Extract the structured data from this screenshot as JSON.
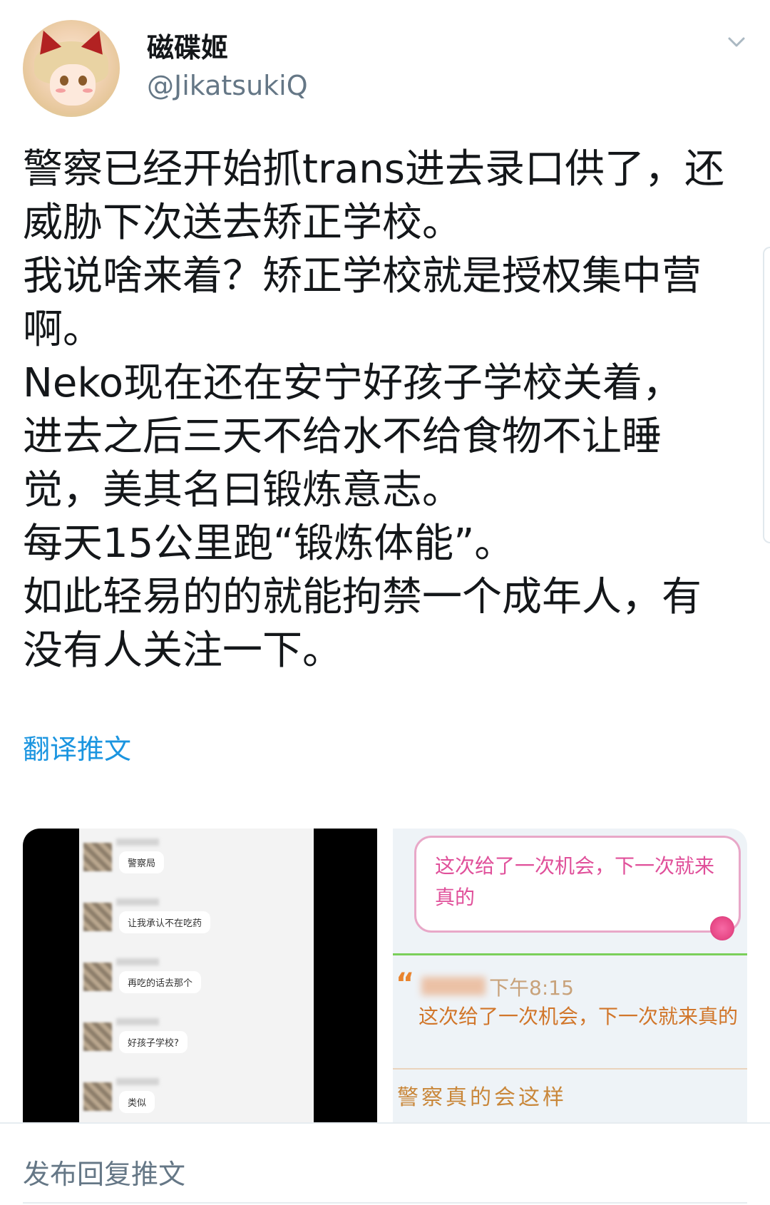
{
  "user": {
    "display_name": "磁碟姬",
    "handle": "@JikatsukiQ"
  },
  "tweet": {
    "lines": [
      "警察已经开始抓trans进去录口供了，还",
      "威胁下次送去矫正学校。",
      "我说啥来着？矫正学校就是授权集中营",
      "啊。",
      "Neko现在还在安宁好孩子学校关着，",
      "进去之后三天不给水不给食物不让睡",
      "觉，美其名曰锻炼意志。",
      "每天15公里跑“锻炼体能”。",
      "如此轻易的的就能拘禁一个成年人，有",
      "没有人关注一下。"
    ],
    "translate_label": "翻译推文"
  },
  "media_left": {
    "messages": [
      "警察局",
      "让我承认不在吃药",
      "再吃的话去那个",
      "好孩子学校?",
      "类似"
    ]
  },
  "media_right": {
    "pink_text": "这次给了一次机会，下一次就来真的",
    "time": "下午8:15",
    "orange_text": "这次给了一次机会，下一次就来真的",
    "sign_text": "警察真的会这样"
  },
  "reply": {
    "placeholder": "发布回复推文"
  },
  "colors": {
    "link": "#1b95e0",
    "secondary_text": "#657786",
    "primary_text": "#14171a"
  },
  "icons": [
    "chevron-down-icon",
    "avatar"
  ]
}
